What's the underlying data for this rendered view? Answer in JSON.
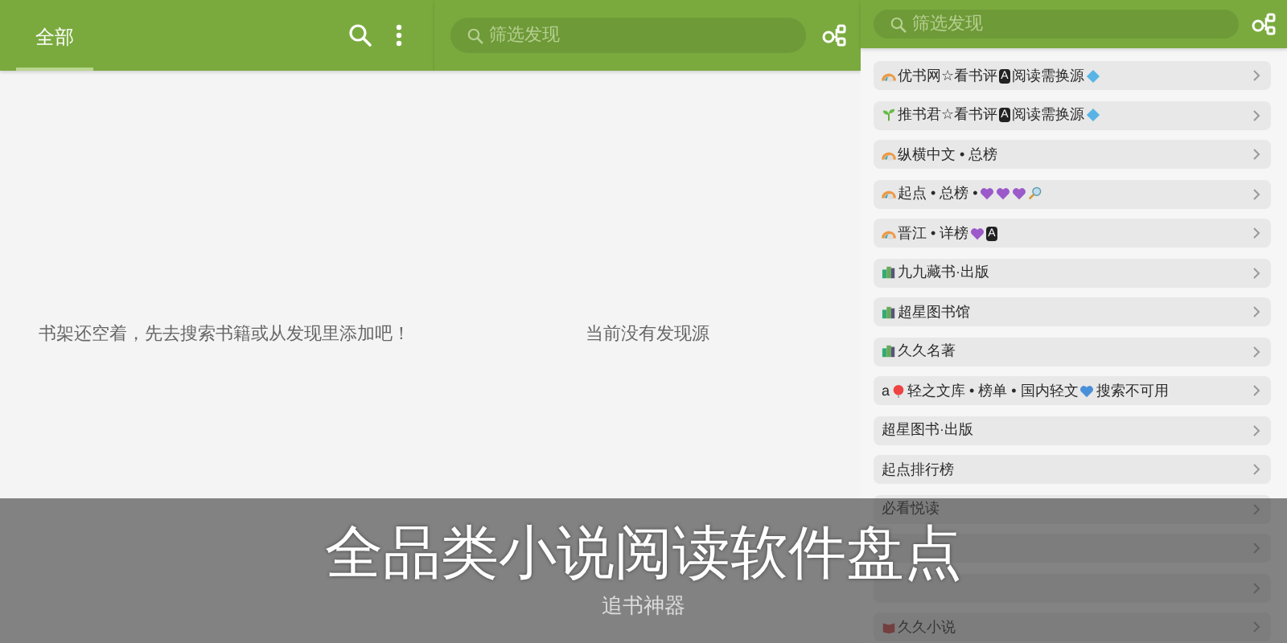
{
  "bookshelf": {
    "tabs": [
      {
        "label": "全部",
        "selected": true
      }
    ],
    "empty_message": "书架还空着，先去搜索书籍或从发现里添加吧！"
  },
  "discover": {
    "search": {
      "placeholder": "筛选发现"
    },
    "empty_message": "当前没有发现源"
  },
  "discover_list": {
    "search": {
      "placeholder": "筛选发现"
    },
    "rows": [
      {
        "parts": [
          {
            "kind": "rainbow"
          },
          {
            "kind": "text",
            "text": "优书网☆看书评"
          },
          {
            "kind": "badge",
            "text": "A"
          },
          {
            "kind": "text",
            "text": "阅读需换源"
          },
          {
            "kind": "diamond"
          }
        ]
      },
      {
        "parts": [
          {
            "kind": "sprout"
          },
          {
            "kind": "text",
            "text": "推书君☆看书评"
          },
          {
            "kind": "badge",
            "text": "A"
          },
          {
            "kind": "text",
            "text": "阅读需换源"
          },
          {
            "kind": "diamond"
          }
        ]
      },
      {
        "parts": [
          {
            "kind": "rainbow"
          },
          {
            "kind": "text",
            "text": "纵横中文 • 总榜"
          }
        ]
      },
      {
        "parts": [
          {
            "kind": "rainbow"
          },
          {
            "kind": "text",
            "text": "起点 • 总榜 •"
          },
          {
            "kind": "heart",
            "color": "#9b59c9"
          },
          {
            "kind": "heart",
            "color": "#9b59c9"
          },
          {
            "kind": "heart",
            "color": "#9b59c9"
          },
          {
            "kind": "magnifier"
          }
        ]
      },
      {
        "parts": [
          {
            "kind": "rainbow"
          },
          {
            "kind": "text",
            "text": "晋江 • 详榜"
          },
          {
            "kind": "heart",
            "color": "#9b59c9"
          },
          {
            "kind": "badge",
            "text": "A"
          }
        ]
      },
      {
        "parts": [
          {
            "kind": "books"
          },
          {
            "kind": "text",
            "text": "九九藏书·出版"
          }
        ]
      },
      {
        "parts": [
          {
            "kind": "books"
          },
          {
            "kind": "text",
            "text": "超星图书馆"
          }
        ]
      },
      {
        "parts": [
          {
            "kind": "books"
          },
          {
            "kind": "text",
            "text": "久久名著"
          }
        ]
      },
      {
        "parts": [
          {
            "kind": "text",
            "text": "a"
          },
          {
            "kind": "balloon"
          },
          {
            "kind": "text",
            "text": "轻之文库 • 榜单 • 国内轻文"
          },
          {
            "kind": "heart",
            "color": "#4a90d9"
          },
          {
            "kind": "text",
            "text": "搜索不可用"
          }
        ]
      },
      {
        "parts": [
          {
            "kind": "text",
            "text": "超星图书·出版"
          }
        ]
      },
      {
        "parts": [
          {
            "kind": "text",
            "text": "起点排行榜"
          }
        ]
      },
      {
        "parts": [
          {
            "kind": "text",
            "text": "必看悦读"
          }
        ]
      },
      {
        "parts": []
      },
      {
        "parts": []
      },
      {
        "parts": [
          {
            "kind": "book"
          },
          {
            "kind": "text",
            "text": "久久小说"
          }
        ]
      }
    ]
  },
  "caption": {
    "title": "全品类小说阅读软件盘点",
    "subtitle": "追书神器"
  }
}
